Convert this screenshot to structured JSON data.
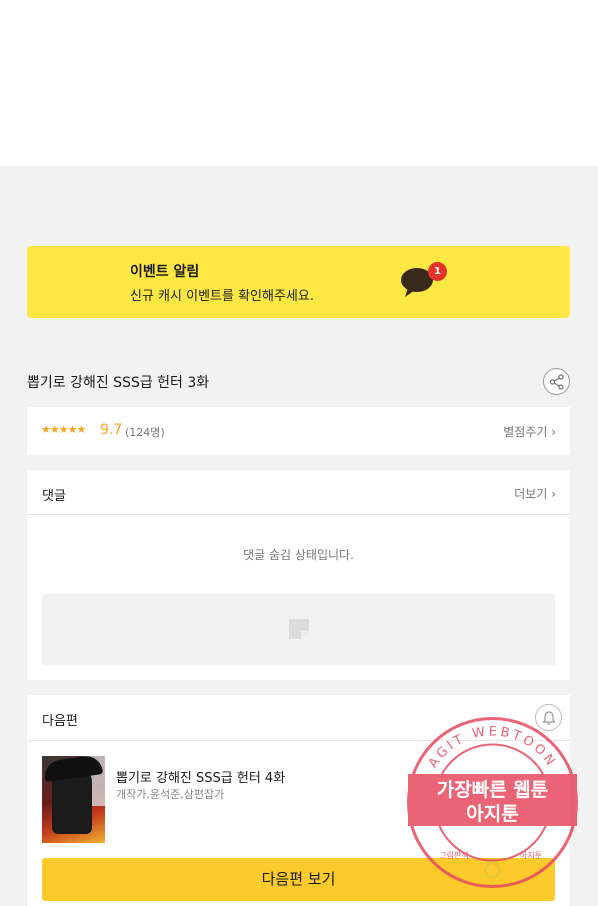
{
  "event": {
    "title": "이벤트 알림",
    "description": "신규 캐시 이벤트를 확인해주세요.",
    "badge_count": "1",
    "bubble_icon": "chat-bubble-icon"
  },
  "episode": {
    "title": "뽑기로 강해진 SSS급 헌터 3화",
    "share_icon": "share-icon"
  },
  "rating": {
    "stars": "★★★★★",
    "score": "9.7",
    "voters": "(124명)",
    "rate_link": "별점주기 ›"
  },
  "comments": {
    "label": "댓글",
    "more_link": "더보기 ›",
    "hidden_message": "댓글 숨김 상태입니다."
  },
  "next_episode": {
    "label": "다음편",
    "title": "뽑기로 강해진 SSS급 헌터 4화",
    "authors": "개작가,윤석준,삼편잡가",
    "button_label": "다음편 보기",
    "bell_icon": "bell-icon"
  },
  "watermark": {
    "ring_text": "AGIT WEBTOON",
    "line1": "가장빠른 웹툰",
    "line2": "아지툰",
    "bottom_left": "그림판책",
    "bottom_right": "아지툰"
  },
  "colors": {
    "event_bg": "#fde843",
    "accent_star": "#f5a623",
    "next_button": "#fcca2a",
    "badge": "#e6332a",
    "watermark": "#e84a5f"
  }
}
